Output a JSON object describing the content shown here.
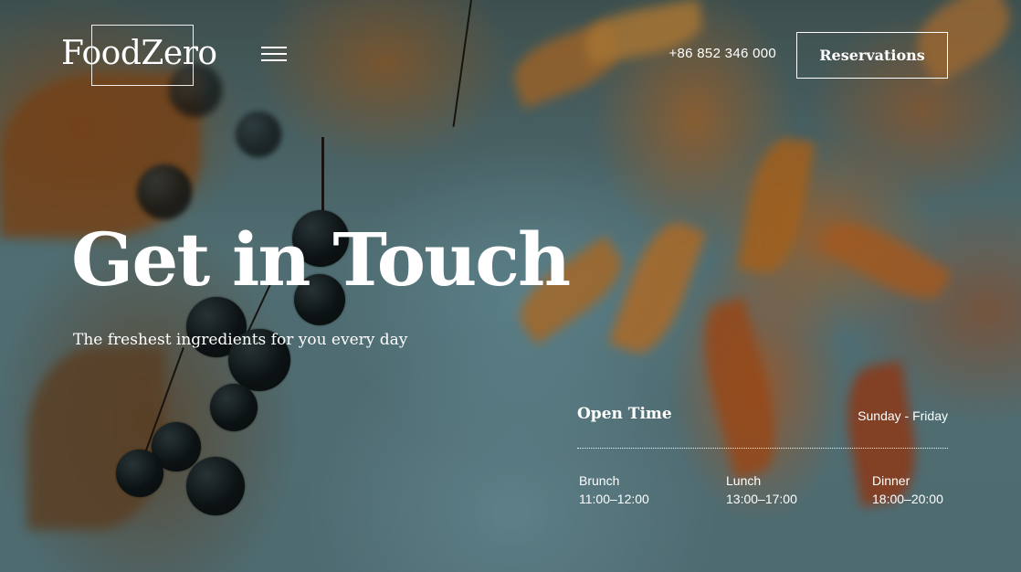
{
  "header": {
    "logo_text": "FoodZero",
    "menu_icon": "hamburger-icon",
    "phone": "+86 852 346 000",
    "reservations_label": "Reservations"
  },
  "hero": {
    "title": "Get in Touch",
    "subtitle": "The freshest ingredients for you every day"
  },
  "open_time": {
    "title": "Open Time",
    "days": "Sunday - Friday",
    "meals": [
      {
        "name": "Brunch",
        "hours": "11:00–12:00"
      },
      {
        "name": "Lunch",
        "hours": "13:00–17:00"
      },
      {
        "name": "Dinner",
        "hours": "18:00–20:00"
      }
    ]
  },
  "colors": {
    "text": "#ffffff",
    "background_teal": "#5f8288",
    "background_orange": "#c06a28"
  }
}
